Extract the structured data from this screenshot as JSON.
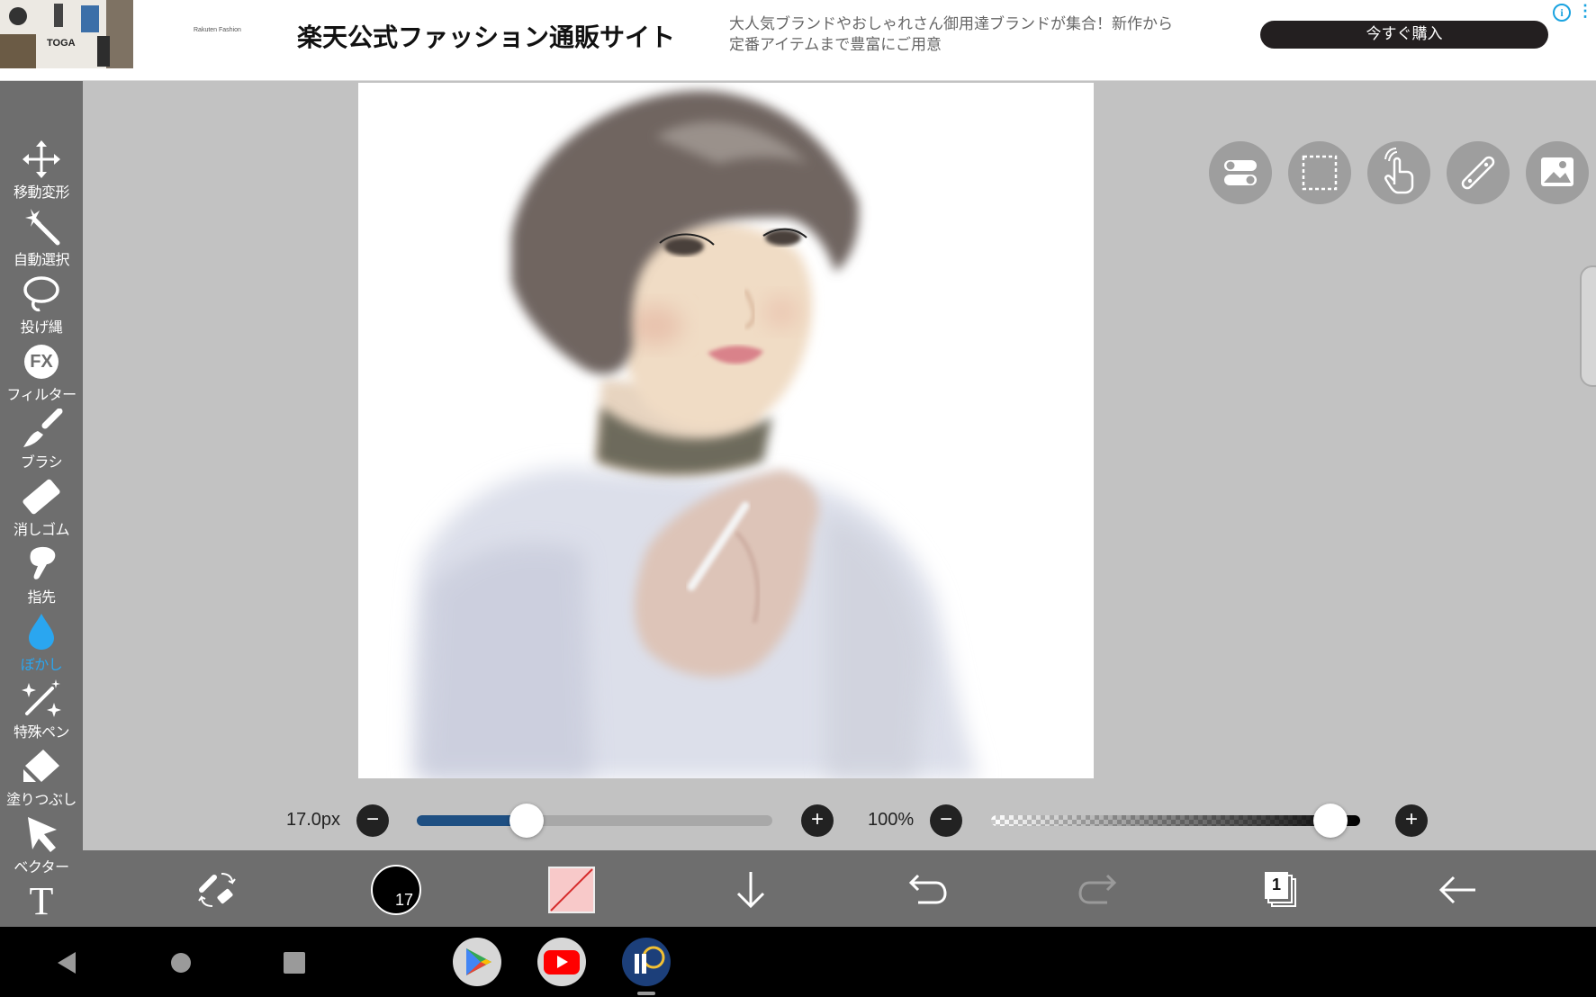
{
  "ad": {
    "thumb_text": "TOGA",
    "logo_text": "Rakuten Fashion",
    "title": "楽天公式ファッション通販サイト",
    "description_line1": "大人気ブランドやおしゃれさん御用達ブランドが集合！新作から",
    "description_line2": "定番アイテムまで豊富にご用意",
    "buy_label": "今すぐ購入",
    "info_icon": "i",
    "more_icon": "⋮"
  },
  "tools": [
    {
      "name": "move",
      "label": "移動変形",
      "icon": "move-icon"
    },
    {
      "name": "auto-select",
      "label": "自動選択",
      "icon": "magic-wand-icon"
    },
    {
      "name": "lasso",
      "label": "投げ縄",
      "icon": "lasso-icon"
    },
    {
      "name": "filter",
      "label": "フィルター",
      "icon": "fx-icon",
      "glyph": "FX"
    },
    {
      "name": "brush",
      "label": "ブラシ",
      "icon": "brush-icon"
    },
    {
      "name": "eraser",
      "label": "消しゴム",
      "icon": "eraser-icon"
    },
    {
      "name": "smudge",
      "label": "指先",
      "icon": "finger-icon"
    },
    {
      "name": "blur",
      "label": "ぼかし",
      "icon": "drop-icon",
      "active": true
    },
    {
      "name": "special-pen",
      "label": "特殊ペン",
      "icon": "sparkle-pen-icon"
    },
    {
      "name": "fill",
      "label": "塗りつぶし",
      "icon": "fill-icon"
    },
    {
      "name": "vector",
      "label": "ベクター",
      "icon": "cursor-arrow-icon"
    },
    {
      "name": "text",
      "label": "",
      "icon": "text-icon",
      "glyph": "T"
    }
  ],
  "sliders": {
    "size_label": "17.0px",
    "size_fraction": 0.31,
    "opacity_label": "100%",
    "opacity_fraction": 0.92,
    "minus": "−",
    "plus": "+"
  },
  "bottom": {
    "brush_size_badge": "17",
    "layer_count": "1"
  },
  "colors": {
    "accent_blue": "#2aa6f0",
    "slider_fill": "#1e4f82",
    "toolbar_gray": "#6e6e6e",
    "workspace_gray": "#c2c2c2",
    "ad_button": "#231f20"
  }
}
